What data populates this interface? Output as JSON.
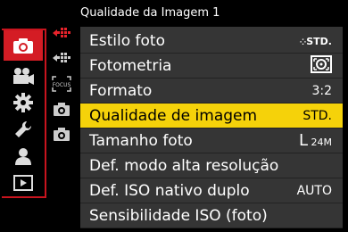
{
  "header": {
    "title": "Qualidade da Imagem 1"
  },
  "tabs": [
    {
      "name": "photo-icon",
      "active": true
    },
    {
      "name": "video-icon"
    },
    {
      "name": "gear-icon"
    },
    {
      "name": "wrench-icon"
    },
    {
      "name": "user-icon"
    },
    {
      "name": "playback-icon"
    }
  ],
  "subtabs": [
    {
      "name": "quality-red-icon"
    },
    {
      "name": "quality-icon"
    },
    {
      "name": "focus-icon"
    },
    {
      "name": "camera-icon-1"
    },
    {
      "name": "camera-icon-2"
    }
  ],
  "menu": {
    "items": [
      {
        "label": "Estilo foto",
        "value": "⁘STD.",
        "selected": false
      },
      {
        "label": "Fotometria",
        "value": "",
        "icon": "metering-icon",
        "selected": false
      },
      {
        "label": "Formato",
        "value": "3:2",
        "selected": false
      },
      {
        "label": "Qualidade de imagem",
        "value": "STD.",
        "selected": true
      },
      {
        "label": "Tamanho foto",
        "value": "L 24M",
        "selected": false
      },
      {
        "label": "Def. modo alta resolução",
        "value": "",
        "selected": false
      },
      {
        "label": "Def. ISO nativo duplo",
        "value": "AUTO",
        "selected": false
      },
      {
        "label": "Sensibilidade ISO (foto)",
        "value": "",
        "selected": false
      }
    ]
  },
  "colors": {
    "accent_red": "#d41c24",
    "highlight_yellow": "#f5d20a",
    "menu_bg": "#353535"
  }
}
